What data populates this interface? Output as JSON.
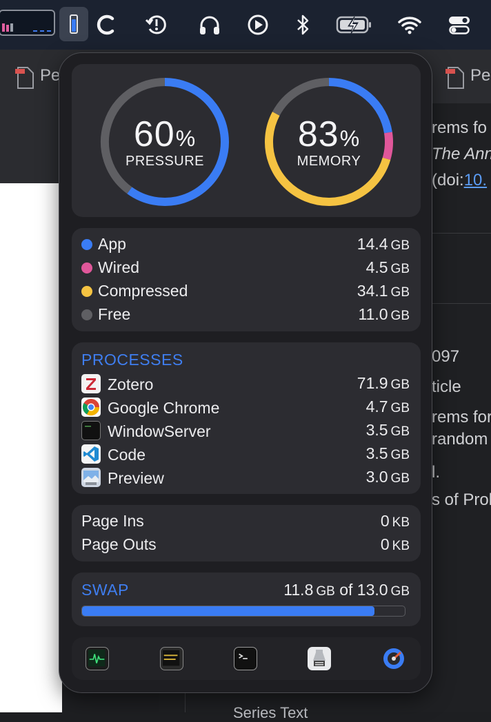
{
  "popover": {
    "gauges": {
      "pressure": {
        "value": "60",
        "pct": "%",
        "caption": "PRESSURE",
        "fraction": 0.6
      },
      "memory": {
        "value": "83",
        "pct": "%",
        "caption": "MEMORY",
        "segments": {
          "app": 14.4,
          "wired": 4.5,
          "compressed": 34.1,
          "free": 11.0
        }
      }
    },
    "breakdown": [
      {
        "label": "App",
        "value": "14.4",
        "unit": "GB",
        "color": "#3a7cf4"
      },
      {
        "label": "Wired",
        "value": "4.5",
        "unit": "GB",
        "color": "#e0579a"
      },
      {
        "label": "Compressed",
        "value": "34.1",
        "unit": "GB",
        "color": "#f5c342"
      },
      {
        "label": "Free",
        "value": "11.0",
        "unit": "GB",
        "color": "#5f5f63"
      }
    ],
    "processes": {
      "title": "PROCESSES",
      "items": [
        {
          "name": "Zotero",
          "value": "71.9",
          "unit": "GB",
          "icon": "zotero-icon"
        },
        {
          "name": "Google Chrome",
          "value": "4.7",
          "unit": "GB",
          "icon": "chrome-icon"
        },
        {
          "name": "WindowServer",
          "value": "3.5",
          "unit": "GB",
          "icon": "windowserver-icon"
        },
        {
          "name": "Code",
          "value": "3.5",
          "unit": "GB",
          "icon": "vscode-icon"
        },
        {
          "name": "Preview",
          "value": "3.0",
          "unit": "GB",
          "icon": "preview-icon"
        }
      ]
    },
    "paging": [
      {
        "label": "Page Ins",
        "value": "0",
        "unit": "KB"
      },
      {
        "label": "Page Outs",
        "value": "0",
        "unit": "KB"
      }
    ],
    "swap": {
      "title": "SWAP",
      "used": "11.8",
      "used_unit": "GB",
      "of": "of",
      "total": "13.0",
      "total_unit": "GB",
      "fraction": 0.907
    },
    "shortcuts": [
      "activity-monitor-icon",
      "console-icon",
      "terminal-icon",
      "system-information-icon",
      "disk-utility-icon"
    ]
  },
  "menubar": {
    "icons": [
      "memory-graph-icon",
      "memory-status-icon",
      "sync-icon",
      "time-machine-icon",
      "headphones-icon",
      "play-icon",
      "bluetooth-icon",
      "battery-charging-icon",
      "wifi-icon",
      "control-center-icon"
    ]
  },
  "background": {
    "tab_text_left": "Pe",
    "tab_text_right": "Pe",
    "lines": [
      "rems fo",
      "The Ann",
      "(doi:",
      "10.",
      "097",
      "ticle",
      "rems for",
      "random",
      "l.",
      "s of Prol"
    ],
    "bottom_text": "Series Text"
  },
  "colors": {
    "accent": "#3a7cf4",
    "wired": "#e0579a",
    "compressed": "#f5c342",
    "free": "#5f5f63"
  }
}
